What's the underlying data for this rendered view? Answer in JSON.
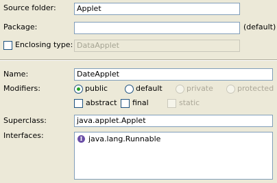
{
  "source_folder": {
    "label": "Source folder:",
    "value": "Applet"
  },
  "package": {
    "label": "Package:",
    "value": "",
    "suffix": "(default)"
  },
  "enclosing_type": {
    "label": "Enclosing type:",
    "value": "DataApplet",
    "checked": false
  },
  "name": {
    "label": "Name:",
    "value": "DateApplet"
  },
  "modifiers": {
    "label": "Modifiers:",
    "access": [
      {
        "label": "public",
        "selected": true,
        "enabled": true
      },
      {
        "label": "default",
        "selected": false,
        "enabled": true
      },
      {
        "label": "private",
        "selected": false,
        "enabled": false
      },
      {
        "label": "protected",
        "selected": false,
        "enabled": false
      }
    ],
    "flags": [
      {
        "label": "abstract",
        "checked": false,
        "enabled": true
      },
      {
        "label": "final",
        "checked": false,
        "enabled": true
      },
      {
        "label": "static",
        "checked": false,
        "enabled": false
      }
    ]
  },
  "superclass": {
    "label": "Superclass:",
    "value": "java.applet.Applet"
  },
  "interfaces": {
    "label": "Interfaces:",
    "items": [
      {
        "icon": "interface-icon",
        "name": "java.lang.Runnable"
      }
    ]
  }
}
